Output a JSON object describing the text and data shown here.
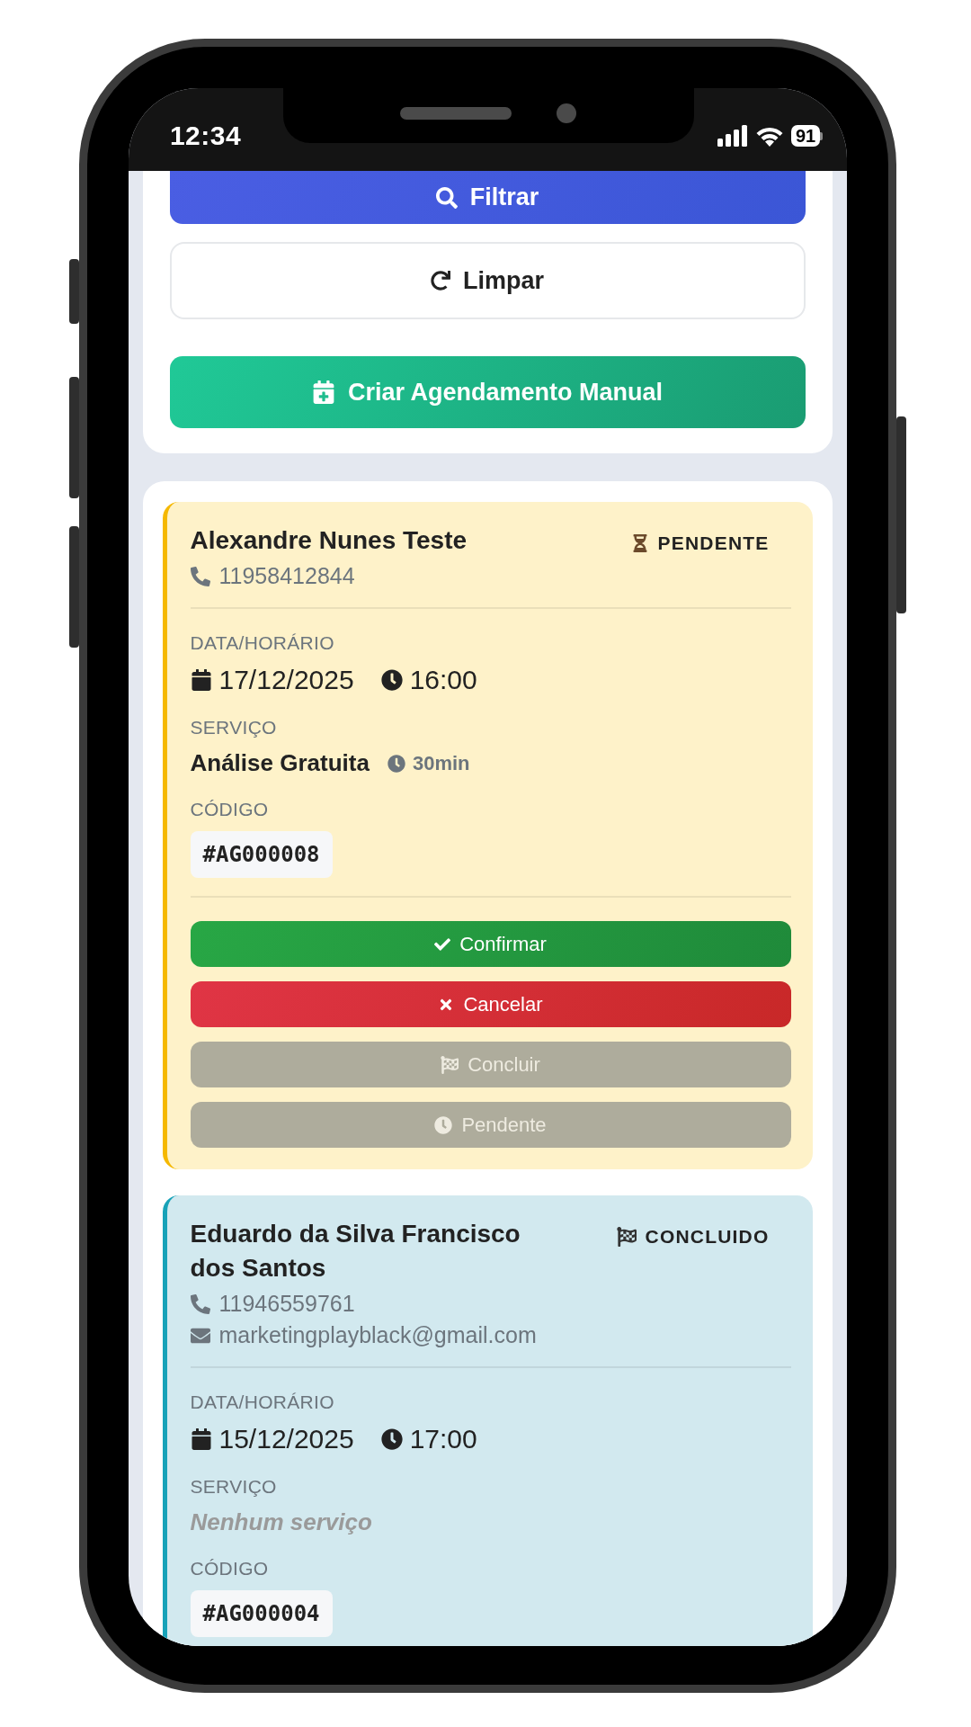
{
  "status_bar": {
    "time": "12:34",
    "battery": "91"
  },
  "filter_actions": [
    {
      "kind": "filter",
      "label": "Filtrar"
    },
    {
      "kind": "clear",
      "label": "Limpar"
    }
  ],
  "create_button": {
    "label": "Criar Agendamento Manual"
  },
  "appointments": [
    {
      "kind": "pending",
      "status_label": "PENDENTE",
      "name": "Alexandre Nunes Teste",
      "phone": "11958412844",
      "date_label": "DATA/HORÁRIO",
      "date": "17/12/2025",
      "time": "16:00",
      "service_label": "SERVIÇO",
      "service": "Análise Gratuita",
      "service_empty": false,
      "duration": "30min",
      "code_label": "CÓDIGO",
      "code": "#AG000008",
      "actions": [
        {
          "kind": "confirm",
          "label": "Confirmar",
          "disabled": false
        },
        {
          "kind": "cancel",
          "label": "Cancelar",
          "disabled": false
        },
        {
          "kind": "complete",
          "label": "Concluir",
          "disabled": true
        },
        {
          "kind": "pending",
          "label": "Pendente",
          "disabled": true
        }
      ]
    },
    {
      "kind": "done",
      "status_label": "CONCLUIDO",
      "name": "Eduardo da Silva Francisco dos Santos",
      "phone": "11946559761",
      "email": "marketingplayblack@gmail.com",
      "date_label": "DATA/HORÁRIO",
      "date": "15/12/2025",
      "time": "17:00",
      "service_label": "SERVIÇO",
      "service": "Nenhum serviço",
      "service_empty": true,
      "code_label": "CÓDIGO",
      "code": "#AG000004"
    }
  ]
}
